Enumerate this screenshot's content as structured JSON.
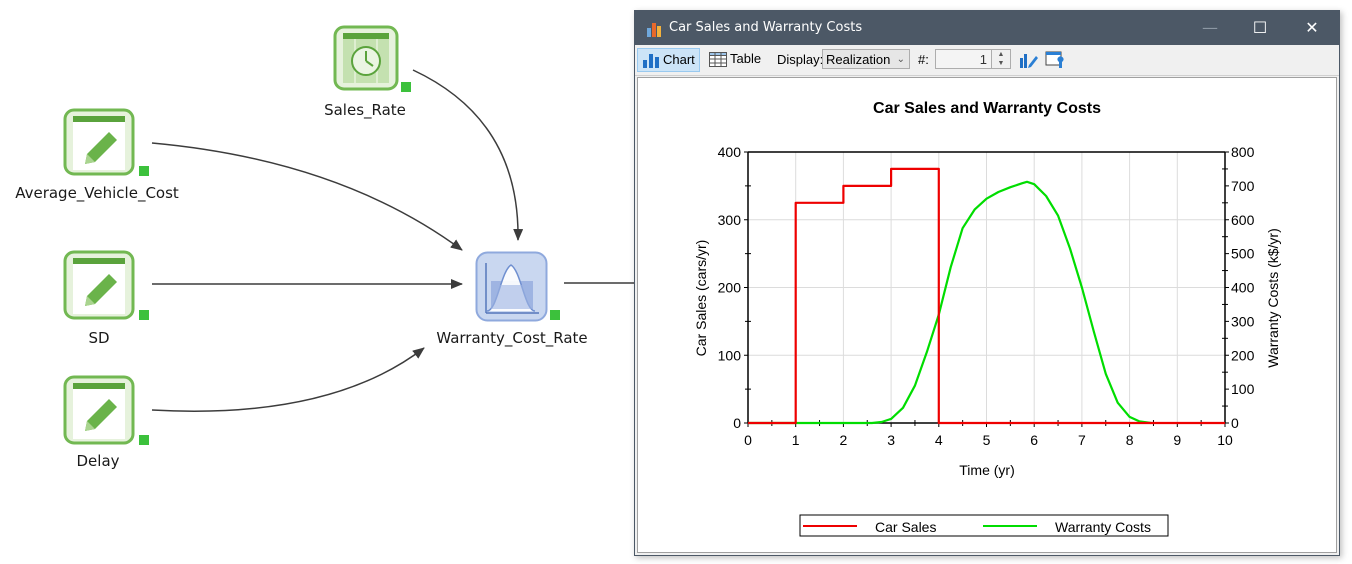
{
  "diagram": {
    "nodes": [
      {
        "id": "sales_rate",
        "label": "Sales_Rate",
        "icon": "timeseries-clock-icon"
      },
      {
        "id": "avg_vehicle_cost",
        "label": "Average_Vehicle_Cost",
        "icon": "data-pencil-icon"
      },
      {
        "id": "sd",
        "label": "SD",
        "icon": "data-pencil-icon"
      },
      {
        "id": "delay",
        "label": "Delay",
        "icon": "data-pencil-icon"
      },
      {
        "id": "warranty_cost_rate",
        "label": "Warranty_Cost_Rate",
        "icon": "distribution-icon"
      }
    ],
    "status_color": "#3cc13c"
  },
  "window": {
    "title": "Car Sales and Warranty Costs",
    "controls": {
      "minimize": "—",
      "maximize": "☐",
      "close": "✕"
    },
    "toolbar": {
      "chart_label": "Chart",
      "table_label": "Table",
      "display_label": "Display:",
      "display_value": "Realization",
      "number_label": "#:",
      "number_value": "1"
    }
  },
  "chart_data": {
    "type": "line",
    "title": "Car Sales and Warranty Costs",
    "xlabel": "Time (yr)",
    "ylabel": "Car Sales (cars/yr)",
    "y2label": "Warranty Costs (k$/yr)",
    "xlim": [
      0,
      10
    ],
    "ylim": [
      0,
      400
    ],
    "y2lim": [
      0,
      800
    ],
    "x_ticks": [
      "0",
      "1",
      "2",
      "3",
      "4",
      "5",
      "6",
      "7",
      "8",
      "9",
      "10"
    ],
    "y_ticks": [
      "0",
      "100",
      "200",
      "300",
      "400"
    ],
    "y2_ticks": [
      "0",
      "100",
      "200",
      "300",
      "400",
      "500",
      "600",
      "700",
      "800"
    ],
    "grid": true,
    "legend_position": "bottom",
    "series": [
      {
        "name": "Car Sales",
        "axis": "left",
        "color": "#ee0000",
        "step": true,
        "x": [
          0,
          1,
          1,
          2,
          2,
          3,
          3,
          4,
          4,
          10
        ],
        "y": [
          0,
          0,
          325,
          325,
          350,
          350,
          375,
          375,
          0,
          0
        ]
      },
      {
        "name": "Warranty Costs",
        "axis": "right",
        "color": "#00dd00",
        "step": false,
        "x": [
          0,
          2.6,
          2.8,
          3.0,
          3.25,
          3.5,
          3.75,
          4.0,
          4.25,
          4.5,
          4.75,
          5.0,
          5.25,
          5.5,
          5.75,
          5.85,
          6.0,
          6.25,
          6.5,
          6.75,
          7.0,
          7.25,
          7.5,
          7.75,
          8.0,
          8.2,
          8.45
        ],
        "y": [
          0,
          0,
          3,
          12,
          45,
          110,
          210,
          320,
          460,
          575,
          630,
          662,
          682,
          696,
          708,
          712,
          705,
          670,
          612,
          515,
          400,
          270,
          145,
          60,
          18,
          5,
          0
        ]
      }
    ]
  }
}
